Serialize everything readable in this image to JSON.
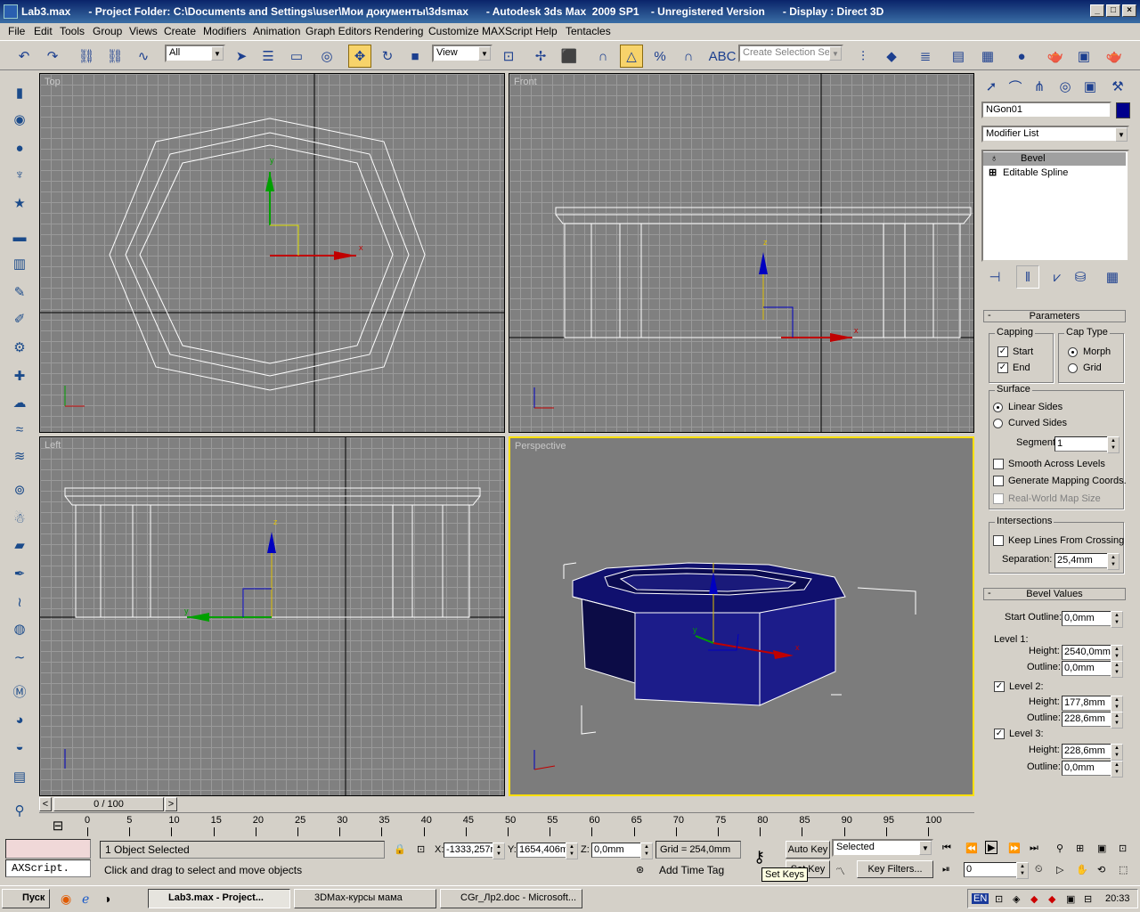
{
  "window": {
    "title": "Lab3.max      - Project Folder: C:\\Documents and Settings\\user\\Мои документы\\3dsmax      - Autodesk 3ds Max  2009 SP1    - Unregistered Version      - Display : Direct 3D"
  },
  "menu": [
    "File",
    "Edit",
    "Tools",
    "Group",
    "Views",
    "Create",
    "Modifiers",
    "Animation",
    "Graph Editors",
    "Rendering",
    "Customize",
    "MAXScript",
    "Help",
    "Tentacles"
  ],
  "toolbar": {
    "filter": "All",
    "ref_coord": "View",
    "selection_set_placeholder": "Create Selection Set"
  },
  "viewports": {
    "top": "Top",
    "front": "Front",
    "left": "Left",
    "perspective": "Perspective"
  },
  "panel": {
    "object_name": "NGon01",
    "object_color": "#00008c",
    "modifier_list": "Modifier List",
    "stack": [
      "Bevel",
      "Editable Spline"
    ],
    "parameters": {
      "title": "Parameters",
      "capping": "Capping",
      "start": "Start",
      "end": "End",
      "cap_type": "Cap Type",
      "morph": "Morph",
      "grid": "Grid",
      "surface": "Surface",
      "linear_sides": "Linear Sides",
      "curved_sides": "Curved Sides",
      "segments_label": "Segments:",
      "segments": "1",
      "smooth": "Smooth Across Levels",
      "gen_mapping": "Generate Mapping Coords.",
      "real_world": "Real-World Map Size",
      "intersections": "Intersections",
      "keep_lines": "Keep Lines From Crossing",
      "separation_label": "Separation:",
      "separation": "25,4mm"
    },
    "bevel": {
      "title": "Bevel Values",
      "start_outline_label": "Start Outline:",
      "start_outline": "0,0mm",
      "level1": "Level 1:",
      "height_label": "Height:",
      "outline_label": "Outline:",
      "l1_height": "2540,0mm",
      "l1_outline": "0,0mm",
      "level2": "Level 2:",
      "l2_height": "177,8mm",
      "l2_outline": "228,6mm",
      "level3": "Level 3:",
      "l3_height": "228,6mm",
      "l3_outline": "0,0mm"
    }
  },
  "timeline": {
    "frame": "0 / 100",
    "ticks": [
      "0",
      "5",
      "10",
      "15",
      "20",
      "25",
      "30",
      "35",
      "40",
      "45",
      "50",
      "55",
      "60",
      "65",
      "70",
      "75",
      "80",
      "85",
      "90",
      "95",
      "100"
    ]
  },
  "status": {
    "maxscript": "AXScript.",
    "selected": "1 Object Selected",
    "prompt": "Click and drag to select and move objects",
    "x": "-1333,257r",
    "y": "1654,406m",
    "z": "0,0mm",
    "grid": "Grid = 254,0mm",
    "add_time_tag": "Add Time Tag",
    "auto_key": "Auto Key",
    "set_key": "Set Key",
    "selected_dd": "Selected",
    "key_filters": "Key Filters...",
    "tooltip": "Set Keys",
    "frame_field": "0",
    "x_label": "X:",
    "y_label": "Y:",
    "z_label": "Z:"
  },
  "taskbar": {
    "start": "Пуск",
    "tasks": [
      "Lab3.max      - Project...",
      "3DMax-курсы мама",
      "CGr_Лр2.doc - Microsoft..."
    ],
    "lang": "EN",
    "clock": "20:33"
  }
}
